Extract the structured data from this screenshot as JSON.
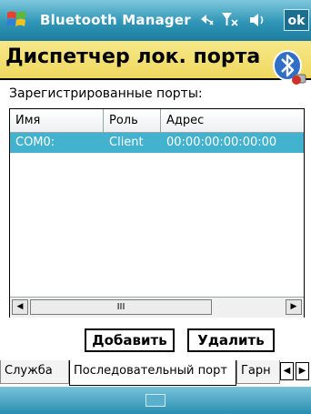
{
  "titlebar": {
    "app_title": "Bluetooth Manager",
    "ok_label": "ok",
    "icons": [
      "start-icon",
      "connectivity-icon",
      "signal-icon",
      "volume-icon"
    ]
  },
  "header": {
    "title": "Диспетчер лок. порта",
    "logo_icon": "bluetooth-icon"
  },
  "section_label": "Зарегистрированные порты:",
  "ports_list": {
    "columns": [
      "Имя",
      "Роль",
      "Адрес"
    ],
    "rows": [
      {
        "name": "COM0:",
        "role": "Client",
        "address": "00:00:00:00:00:00",
        "selected": true
      }
    ],
    "scroll_thumb": "III"
  },
  "buttons": {
    "add": "Добавить",
    "delete": "Удалить"
  },
  "tabs": [
    {
      "label": "Служба"
    },
    {
      "label": "Последовательный порт",
      "active": true
    },
    {
      "label": "Гарн"
    }
  ],
  "colors": {
    "titlebar": "#2f95b6",
    "header": "#f0d85e",
    "selected_row": "#42b2cf"
  }
}
